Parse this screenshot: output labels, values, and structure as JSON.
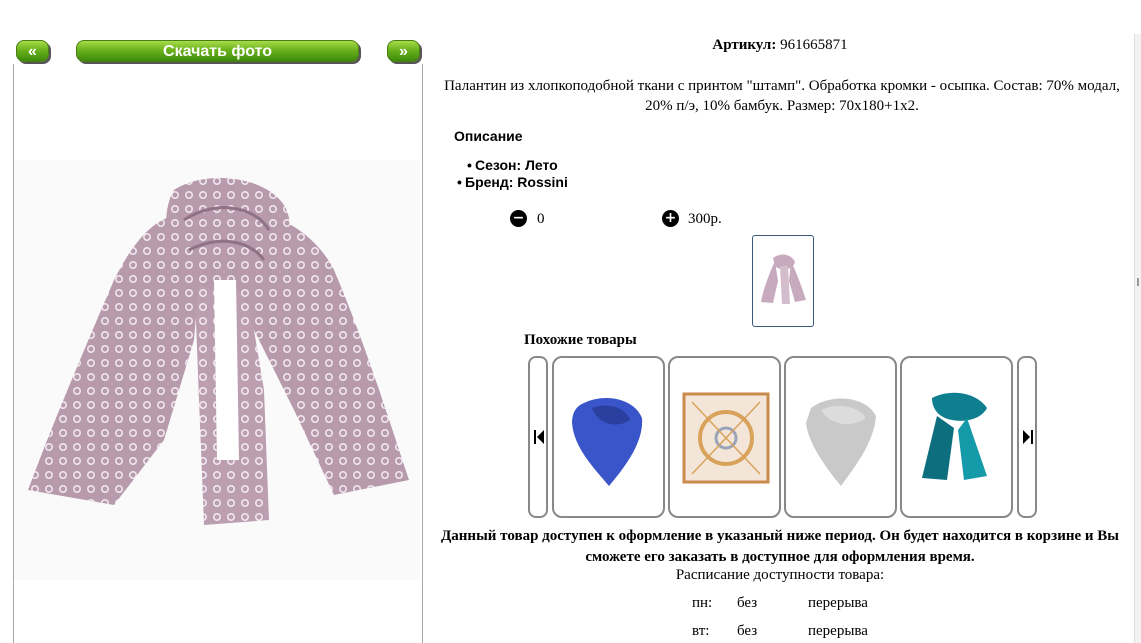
{
  "gallery": {
    "prev_label": "«",
    "download_label": "Скачать фото",
    "next_label": "»"
  },
  "product": {
    "article_label": "Артикул:",
    "article_value": "961665871",
    "description": "Палантин из хлопкоподобной ткани с принтом \"штамп\". Обработка кромки - осыпка. Состав: 70% модал, 20% п/э, 10% бамбук. Размер: 70х180+1х2.",
    "description_heading": "Описание",
    "properties": [
      "Сезон: Лето",
      "Бренд: Rossini"
    ],
    "quantity": "0",
    "price": "300р."
  },
  "similar": {
    "title": "Похожие товары",
    "items": [
      {
        "name": "blue-scarf",
        "color": "#3a54c9"
      },
      {
        "name": "patterned-square-scarf",
        "color": "#d9a25a"
      },
      {
        "name": "grey-scarf",
        "color": "#c9c9c9"
      },
      {
        "name": "teal-scarf",
        "color": "#0f7f8f"
      }
    ]
  },
  "availability": {
    "notice": "Данный товар доступен к оформление в указаный ниже период. Он будет находится в корзине и Вы сможете его заказать в доступное для оформления время.",
    "schedule_title": "Расписание доступности товара:",
    "rows": [
      {
        "day": "пн:",
        "from": "без",
        "to": "перерыва"
      },
      {
        "day": "вт:",
        "from": "без",
        "to": "перерыва"
      }
    ]
  }
}
